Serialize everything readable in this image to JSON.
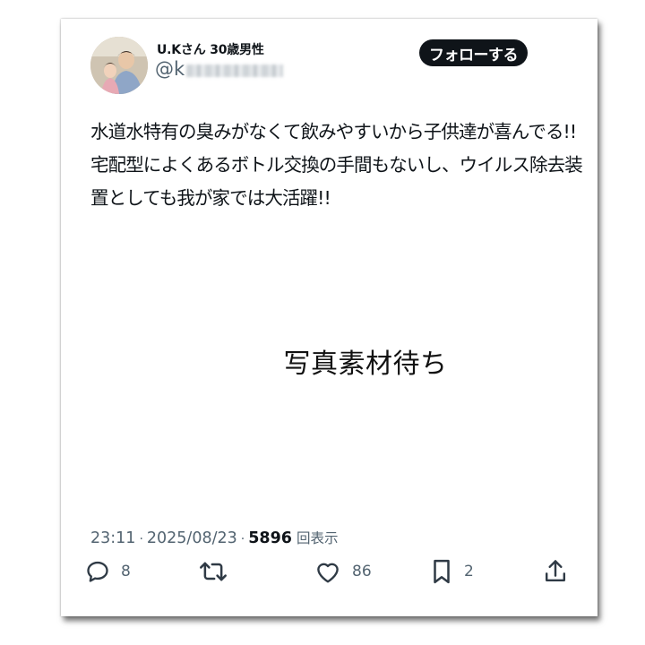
{
  "user": {
    "display_name": "U.Kさん 30歳男性",
    "handle_prefix": "@k",
    "avatar_icon": "profile-photo"
  },
  "follow_button": {
    "label": "フォローする"
  },
  "tweet": {
    "text": "水道水特有の臭みがなくて飲みやすいから子供達が喜んでる!!宅配型によくあるボトル交換の手間もないし、ウイルス除去装置としても我が家では大活躍!!",
    "media_placeholder": "写真素材待ち"
  },
  "meta": {
    "time": "23:11",
    "date": "2025/08/23",
    "separator": "·",
    "views_count": "5896",
    "views_label": "回表示"
  },
  "actions": {
    "reply": {
      "icon": "reply-icon",
      "count": "8"
    },
    "retweet": {
      "icon": "retweet-icon",
      "count": ""
    },
    "like": {
      "icon": "heart-icon",
      "count": "86"
    },
    "bookmark": {
      "icon": "bookmark-icon",
      "count": "2"
    },
    "share": {
      "icon": "share-icon",
      "count": ""
    }
  },
  "colors": {
    "text_primary": "#0f1419",
    "text_secondary": "#536471",
    "button_bg": "#0f1419",
    "button_text": "#ffffff"
  }
}
